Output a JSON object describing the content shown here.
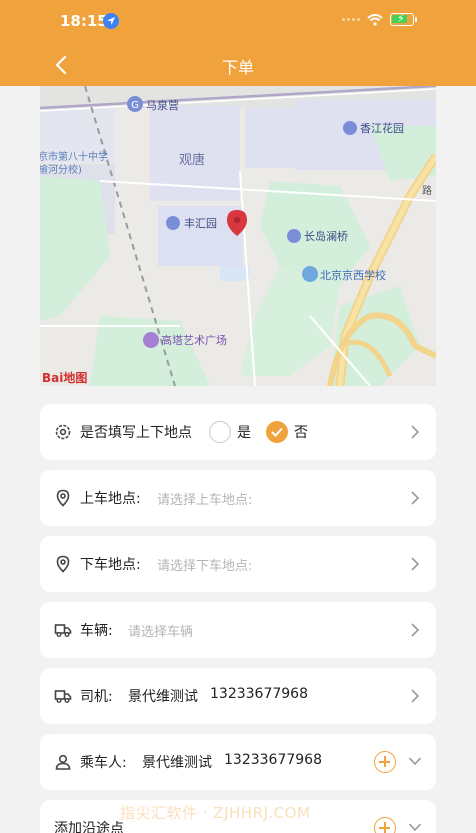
{
  "status_bar": {
    "time": "18:15"
  },
  "header": {
    "title": "下单"
  },
  "map": {
    "labels": {
      "maquanying": "马泉营",
      "school": "京市第八十中学",
      "school_branch": "榆河分校)",
      "guantang": "观唐",
      "xiangjiang": "香江花园",
      "fenghui": "丰汇园",
      "changdao": "长岛澜桥",
      "jingxi": "北京京西学校",
      "gaota": "高塔艺术广场",
      "road": "路"
    },
    "logo": "Bai地图"
  },
  "form": {
    "fill_points": {
      "label": "是否填写上下地点",
      "option_yes": "是",
      "option_no": "否",
      "selected": "否"
    },
    "pickup": {
      "label": "上车地点:",
      "placeholder": "请选择上车地点:"
    },
    "dropoff": {
      "label": "下车地点:",
      "placeholder": "请选择下车地点:"
    },
    "vehicle": {
      "label": "车辆:",
      "placeholder": "请选择车辆"
    },
    "driver": {
      "label": "司机:",
      "name": "景代维测试",
      "phone": "13233677968"
    },
    "passenger": {
      "label": "乘车人:",
      "name": "景代维测试",
      "phone": "13233677968"
    },
    "waypoint": {
      "label": "添加沿途点"
    }
  },
  "watermark": "指尖汇软件 · ZJHHRJ.COM",
  "colors": {
    "accent": "#f0a33c",
    "pin": "#d9363e",
    "water": "#cfe0f3",
    "park": "#cdeed9"
  }
}
